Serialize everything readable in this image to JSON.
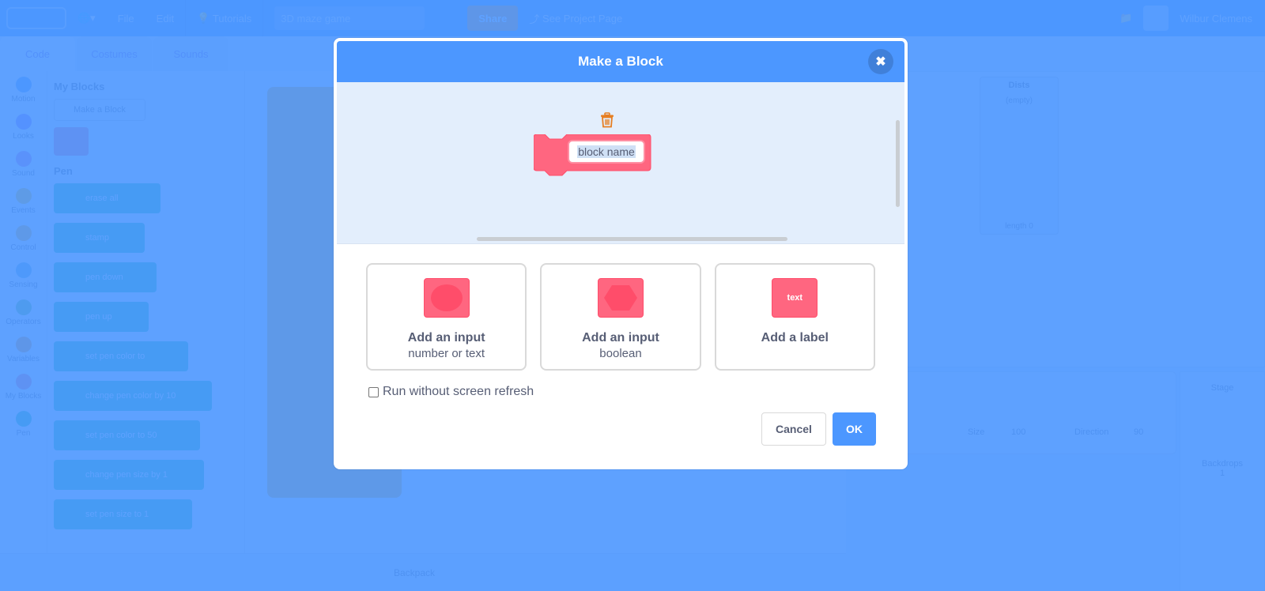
{
  "menubar": {
    "items": [
      "File",
      "Edit"
    ],
    "tutorials": "Tutorials",
    "project_title": "3D maze game",
    "share": "Share",
    "see_project_page": "See Project Page",
    "username": "Wilbur Clemens"
  },
  "editor_tabs": [
    "Code",
    "Costumes",
    "Sounds"
  ],
  "categories": [
    "Motion",
    "Looks",
    "Sound",
    "Events",
    "Control",
    "Sensing",
    "Operators",
    "Variables",
    "My Blocks",
    "Pen"
  ],
  "category_colors": [
    "#4c97ff",
    "#9966ff",
    "#cf63cf",
    "#ffbf00",
    "#ffab19",
    "#5cb1d6",
    "#59c059",
    "#ff8c1a",
    "#ff6680",
    "#0fbd8c"
  ],
  "palette": {
    "my_blocks_heading": "My Blocks",
    "make_block_button": "Make a Block",
    "pen_heading": "Pen",
    "pen_blocks": [
      "erase all",
      "stamp",
      "pen down",
      "pen up",
      "set pen color to",
      "change pen color by 10",
      "set pen color to 50",
      "change pen size by 1",
      "set pen size to 1"
    ]
  },
  "backpack_label": "Backpack",
  "stage": {
    "monitor_title": "Dists",
    "monitor_empty": "(empty)",
    "monitor_length": "length 0"
  },
  "sprite_info": {
    "size_label": "Size",
    "size_value": "100",
    "direction_label": "Direction",
    "direction_value": "90"
  },
  "stage_pane": {
    "title": "Stage",
    "backdrops_label": "Backdrops",
    "backdrops_count": "1"
  },
  "modal": {
    "title": "Make a Block",
    "close_icon": "close-icon",
    "block_name_value": "block name",
    "options": [
      {
        "title": "Add an input",
        "subtitle": "number or text",
        "icon": "oval-input-icon"
      },
      {
        "title": "Add an input",
        "subtitle": "boolean",
        "icon": "boolean-input-icon"
      },
      {
        "title": "Add a label",
        "subtitle": "",
        "icon": "label-icon",
        "icon_text": "text"
      }
    ],
    "checkbox_label": "Run without screen refresh",
    "checkbox_checked": false,
    "cancel_label": "Cancel",
    "ok_label": "OK"
  },
  "colors": {
    "accent": "#4c97ff",
    "custom_block": "#ff6680",
    "custom_block_dark": "#ff4d6a",
    "trash_icon": "#e67e22",
    "preview_bg": "#e3eefc",
    "text": "#575e75"
  }
}
